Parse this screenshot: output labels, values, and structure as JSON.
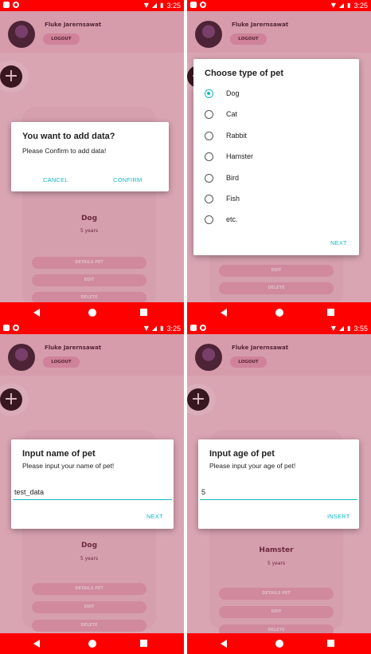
{
  "status": {
    "time_1": "3:25",
    "time_2": "3:25",
    "time_3": "3:25",
    "time_4": "3:55"
  },
  "header": {
    "username": "Fluke Jarernsawat",
    "logout_label": "LOGOUT"
  },
  "pets": {
    "card1": {
      "type": "Dog",
      "age": "5 years"
    },
    "card3": {
      "type": "Dog",
      "age": "5 years"
    },
    "card4": {
      "type": "Hamster",
      "age": "5 years"
    }
  },
  "pet_buttons": {
    "detail": "DETAILS PET",
    "edit": "EDIT",
    "delete": "DELETE"
  },
  "confirm_dialog": {
    "title": "You want to add data?",
    "message": "Please Confirm to add data!",
    "cancel": "CANCEL",
    "confirm": "CONFIRM"
  },
  "type_dialog": {
    "title": "Choose type of pet",
    "options": [
      "Dog",
      "Cat",
      "Rabbit",
      "Hamster",
      "Bird",
      "Fish",
      "etc."
    ],
    "selected": "Dog",
    "next": "NEXT"
  },
  "name_dialog": {
    "title": "Input name of pet",
    "message": "Please input your name of pet!",
    "value": "test_data",
    "next": "NEXT"
  },
  "age_dialog": {
    "title": "Input age of pet",
    "message": "Please input your age of pet!",
    "value": "5",
    "insert": "INSERT"
  },
  "colors": {
    "status_bar": "#ff0000",
    "accent": "#12b8c6",
    "app_bg": "#f7dbe3"
  },
  "icons": [
    "sim-icon",
    "circle-notification-icon",
    "wifi-icon",
    "signal-icon",
    "battery-icon",
    "add-icon",
    "back-icon",
    "home-icon",
    "recent-apps-icon"
  ]
}
